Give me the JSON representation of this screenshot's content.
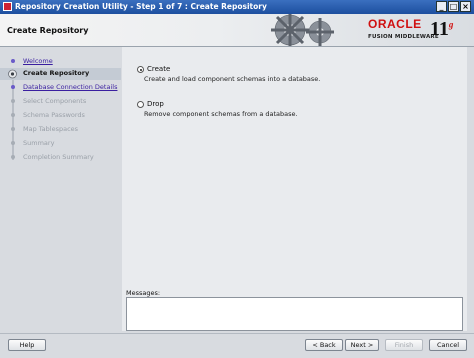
{
  "window": {
    "title": "Repository Creation Utility - Step 1 of 7 : Create Repository",
    "minimize_glyph": "_",
    "maximize_glyph": "□",
    "close_glyph": "×"
  },
  "header": {
    "page_title": "Create Repository",
    "brand": "ORACLE",
    "product": "FUSION MIDDLEWARE",
    "version": "11",
    "version_suffix": "g"
  },
  "nav": {
    "steps": [
      {
        "label": "Welcome",
        "state": "link"
      },
      {
        "label": "Create Repository",
        "state": "active"
      },
      {
        "label": "Database Connection Details",
        "state": "link"
      },
      {
        "label": "Select Components",
        "state": "disabled"
      },
      {
        "label": "Schema Passwords",
        "state": "disabled"
      },
      {
        "label": "Map Tablespaces",
        "state": "disabled"
      },
      {
        "label": "Summary",
        "state": "disabled"
      },
      {
        "label": "Completion Summary",
        "state": "disabled"
      }
    ]
  },
  "options": {
    "create": {
      "label": "Create",
      "description": "Create and load component schemas into a database.",
      "selected": true
    },
    "drop": {
      "label": "Drop",
      "description": "Remove component schemas from a database.",
      "selected": false
    }
  },
  "messages": {
    "label": "Messages:",
    "value": ""
  },
  "buttons": {
    "help": "Help",
    "back": "< Back",
    "next": "Next >",
    "finish": "Finish",
    "cancel": "Cancel"
  },
  "colors": {
    "brand_red": "#d01010",
    "link": "#3a1fa0",
    "titlebar": "#1d4f9f"
  }
}
